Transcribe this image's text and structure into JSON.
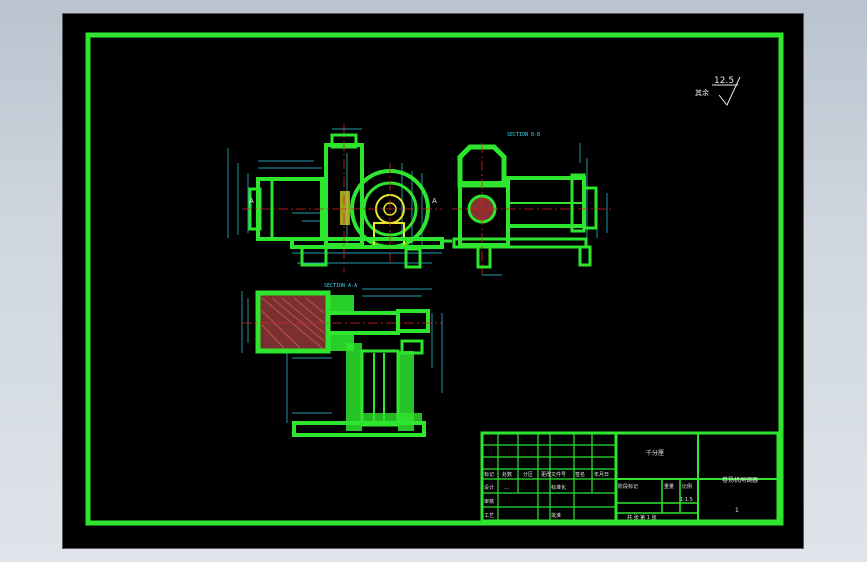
{
  "colors": {
    "background": "#000000",
    "frame": "#2ee62e",
    "dimension": "#2fd2e6",
    "centerline": "#e02020",
    "hatch": "#b04040",
    "highlight": "#e6e62a",
    "text": "#e8e8e8"
  },
  "surface_finish": {
    "value": "12.5",
    "label": "其余"
  },
  "views": {
    "section_b": "SECTION B-B",
    "section_a": "SECTION A-A",
    "cut_label_left": "A",
    "cut_label_right": "A"
  },
  "title_block": {
    "company": "千分厘",
    "drawing_name": "卷扬机闸调器",
    "sheet_no": "1",
    "scale": "1:1.5",
    "stage_label": "阶段标记",
    "weight_label": "重量",
    "scale_label": "比例",
    "sheets_text": "共 张 第 1 张",
    "revision_headers": [
      "标记",
      "处数",
      "分区",
      "更改文件号",
      "签名",
      "年月日"
    ],
    "row_labels": [
      "设计",
      "审核",
      "工艺"
    ],
    "std_label": "标准化",
    "approve_label": "批准",
    "designer_date": "…"
  }
}
